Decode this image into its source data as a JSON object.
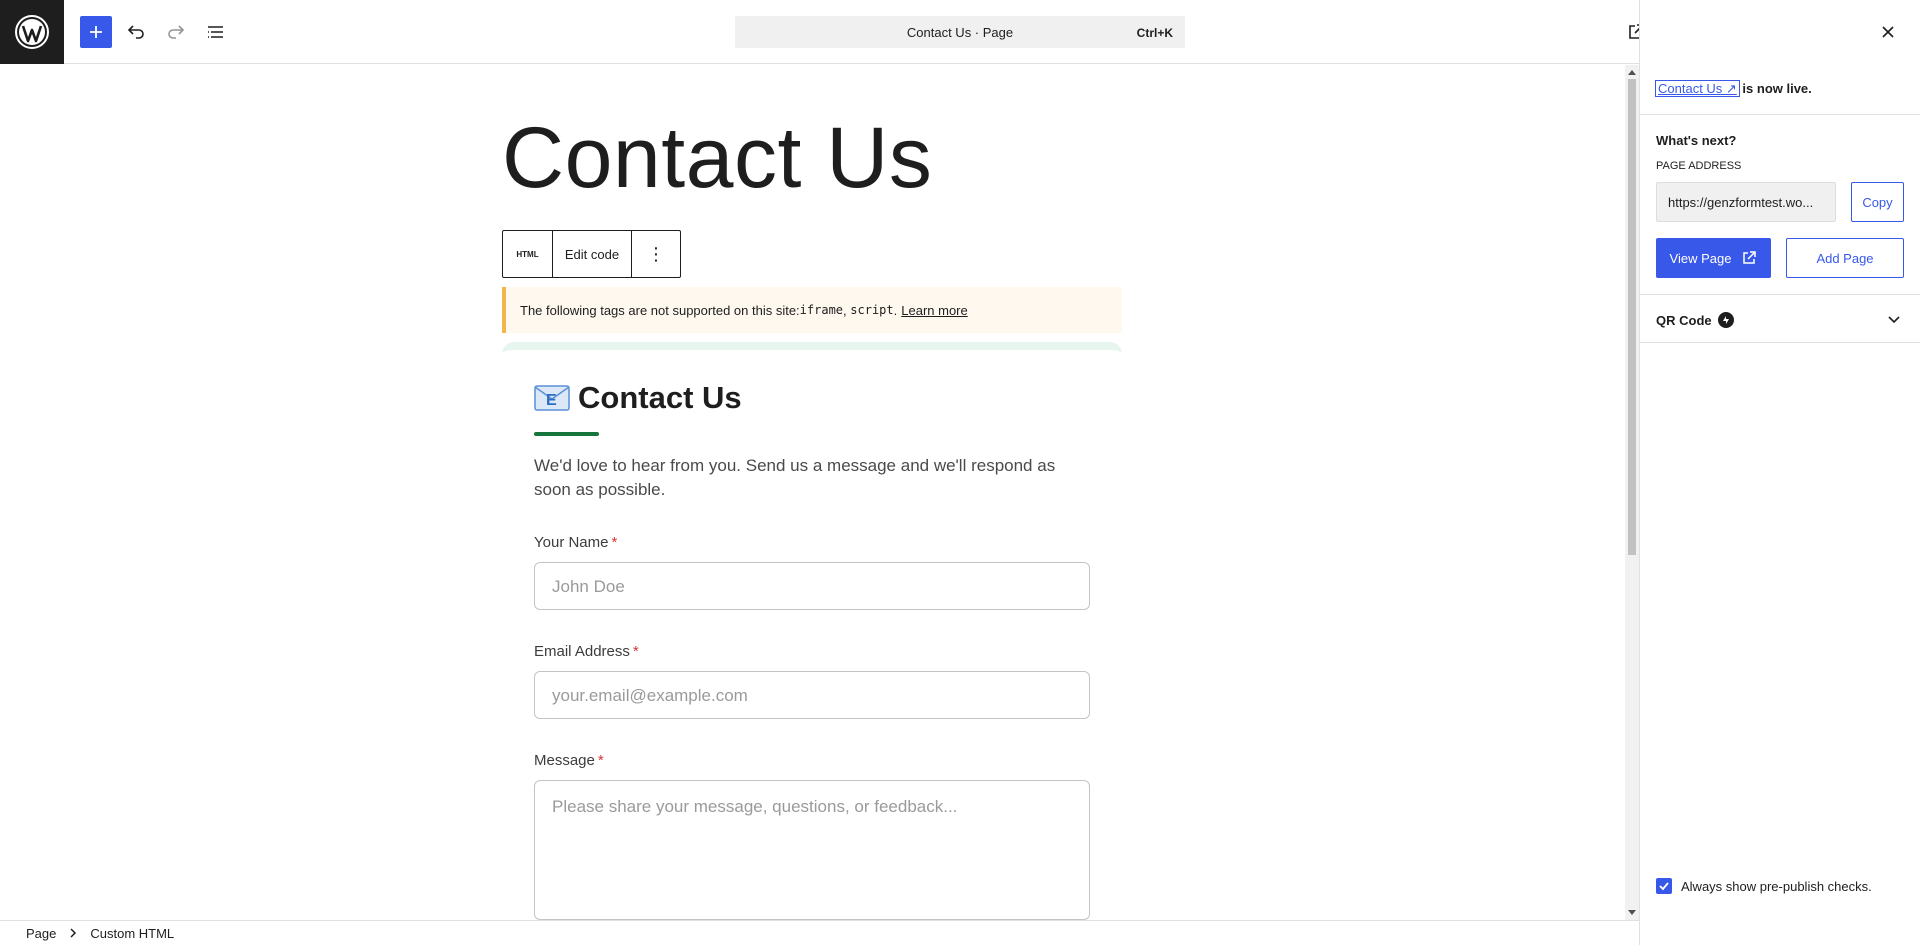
{
  "header": {
    "wp_logo": "wordpress-logo",
    "add_block_icon": "plus-icon",
    "undo_icon": "undo-icon",
    "redo_icon": "redo-icon",
    "list_view_icon": "list-view-icon",
    "command_title": "Contact Us · Page",
    "command_shortcut": "Ctrl+K",
    "preview_icon": "external-link-icon"
  },
  "editor": {
    "page_title": "Contact Us",
    "block_toolbar": {
      "html_label": "HTML",
      "edit_code_label": "Edit code",
      "more_label": "⋮"
    },
    "notice": {
      "prefix": "The following tags are not supported on this site: ",
      "tag1": "iframe",
      "comma": ", ",
      "tag2": "script",
      "period": ".",
      "learn_more": "Learn more"
    },
    "form": {
      "title": "Contact Us",
      "intro": "We'd love to hear from you. Send us a message and we'll respond as soon as possible.",
      "required_mark": "*",
      "fields": [
        {
          "label": "Your Name",
          "placeholder": "John Doe"
        },
        {
          "label": "Email Address",
          "placeholder": "your.email@example.com"
        },
        {
          "label": "Message",
          "placeholder": "Please share your message, questions, or feedback..."
        }
      ]
    }
  },
  "sidebar": {
    "close_icon": "close-icon",
    "live_link": "Contact Us ↗",
    "live_text": " is now live.",
    "whats_next": "What's next?",
    "address_label": "PAGE ADDRESS",
    "address_value": "https://genzformtest.wo...",
    "copy_label": "Copy",
    "view_page_label": "View Page",
    "add_page_label": "Add Page",
    "qr_label": "QR Code",
    "prepublish_label": "Always show pre-publish checks.",
    "prepublish_checked": true
  },
  "footer": {
    "crumb_page": "Page",
    "crumb_block": "Custom HTML"
  },
  "colors": {
    "accent": "#3858e9",
    "form_underline": "#16753a",
    "notice_border": "#f0b849",
    "required": "#d63638"
  }
}
